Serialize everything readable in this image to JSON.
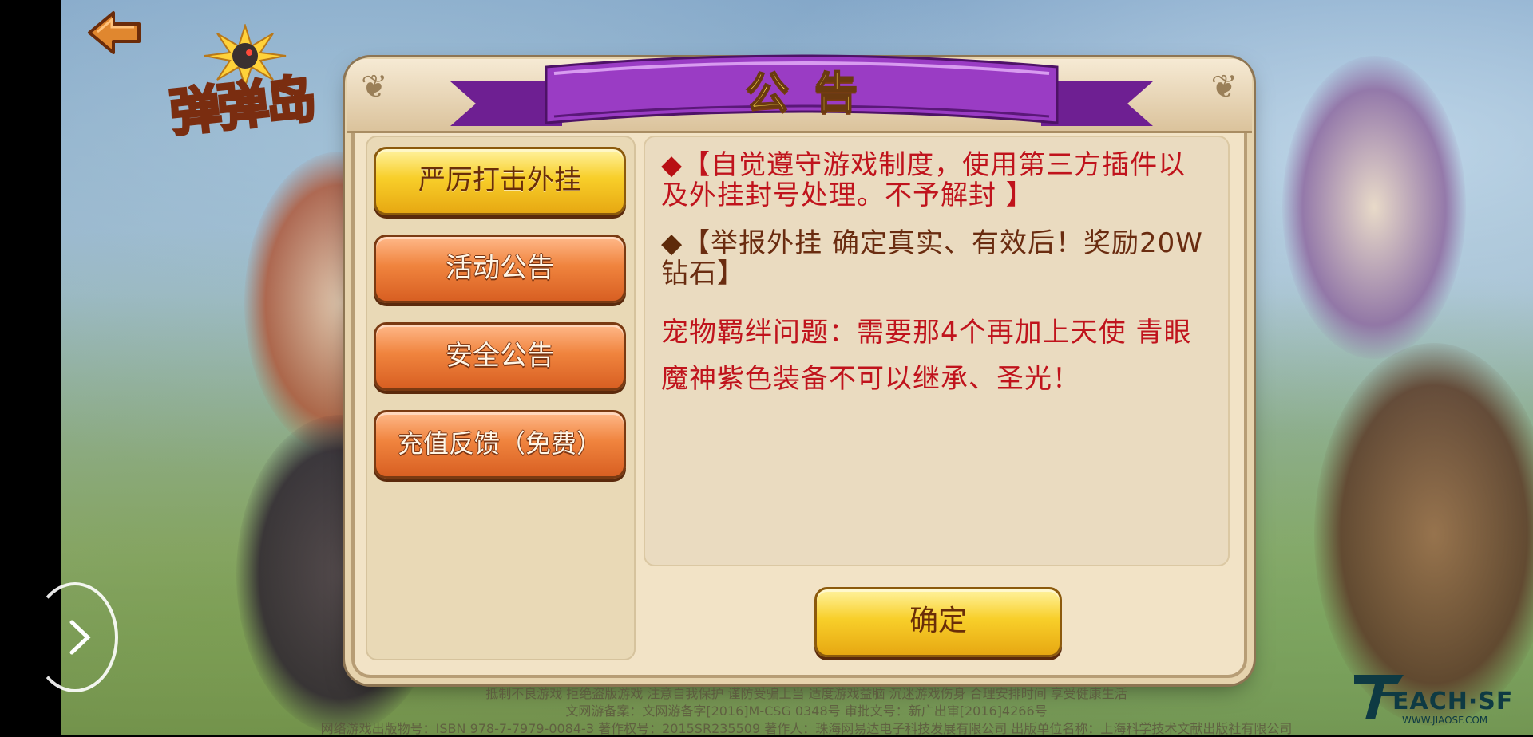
{
  "dialog": {
    "title": "公告",
    "tabs": [
      {
        "label": "严厉打击外挂",
        "active": true
      },
      {
        "label": "活动公告",
        "active": false
      },
      {
        "label": "安全公告",
        "active": false
      },
      {
        "label": "充值反馈（免费）",
        "active": false
      }
    ],
    "content": {
      "p1_marker": "◆",
      "p1_text": "【自觉遵守游戏制度，使用第三方插件以及外挂封号处理。不予解封  】",
      "p2_marker": "◆",
      "p2_text": "【举报外挂  确定真实、有效后！奖励20W钻石】",
      "p3_text": "宠物羁绊问题：需要那4个再加上天使  青眼魔神紫色装备不可以继承、圣光！"
    },
    "confirm_label": "确定"
  },
  "logo": {
    "text": "弹弹岛"
  },
  "footer": {
    "line1": "抵制不良游戏  拒绝盗版游戏  注意自我保护  谨防受骗上当  适度游戏益脑  沉迷游戏伤身  合理安排时间  享受健康生活",
    "line2": "文网游备案：文网游备字[2016]M-CSG 0348号  审批文号：新广出审[2016]4266号",
    "line3": "网络游戏出版物号：ISBN 978-7-7979-0084-3  著作权号：2015SR235509  著作人：珠海网易达电子科技发展有限公司  出版单位名称：上海科学技术文献出版社有限公司"
  },
  "watermark": {
    "text": "EACH·SF",
    "sub": "WWW.JIAOSF.COM"
  },
  "colors": {
    "accent_gold": "#f8cf2a",
    "accent_orange": "#f0843e",
    "ribbon_purple": "#8a2fb0",
    "notice_red": "#c0131c"
  }
}
